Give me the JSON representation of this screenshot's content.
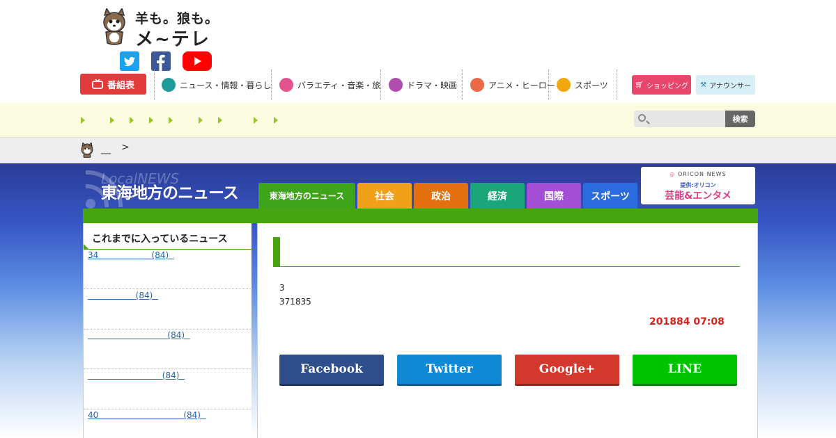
{
  "logo": {
    "line1": "羊も。狼も。",
    "line2": "メ~テレ"
  },
  "social": {
    "twitter": "twitter-icon",
    "facebook": "facebook-icon",
    "youtube": "youtube-icon"
  },
  "nav": {
    "program_guide": "番組表",
    "items": [
      "ニュース・情報・暮らし",
      "バラエティ・音楽・旅",
      "ドラマ・映画",
      "アニメ・ヒーロー",
      "スポーツ"
    ],
    "shopping": "ショッピング",
    "announcer": "アナウンサー"
  },
  "search": {
    "placeholder": "",
    "button": "検索"
  },
  "breadcrumb": {
    "dash": "__",
    "sep": ">"
  },
  "section": {
    "watermark": "LocalNEWS",
    "title": "東海地方のニュース",
    "tabs": [
      "東海地方のニュース",
      "社会",
      "政治",
      "経済",
      "国際",
      "スポーツ"
    ]
  },
  "oricon": {
    "top": "ORICON NEWS",
    "mid": "提供:オリコン",
    "bottom": "芸能&エンタメ"
  },
  "sidebar": {
    "heading": "これまでに入っているニュース",
    "items": [
      "34                    (84)  ",
      "                  (84)  ",
      "                              (84)  ",
      "                            (84)  ",
      "40                                (84)  "
    ]
  },
  "article": {
    "line1": "3",
    "line2": "371835",
    "date": "201884 07:08"
  },
  "share": {
    "facebook": "Facebook",
    "twitter": "Twitter",
    "google": "Google+",
    "line": "LINE"
  },
  "colors": {
    "accent_green": "#48a512",
    "date_red": "#d9211c",
    "link_blue": "#2461a8"
  }
}
